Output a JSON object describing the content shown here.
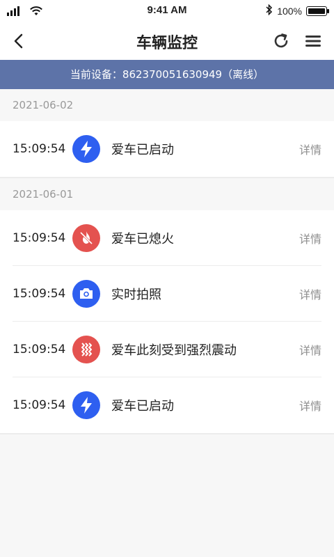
{
  "status": {
    "time": "9:41 AM",
    "battery": "100%"
  },
  "nav": {
    "title": "车辆监控"
  },
  "device": {
    "label": "当前设备：862370051630949（离线）"
  },
  "groups": [
    {
      "date": "2021-06-02",
      "items": [
        {
          "time": "15:09:54",
          "icon": "lightning-icon",
          "color": "#2e5ff0",
          "text": "爱车已启动",
          "detail": "详情"
        }
      ]
    },
    {
      "date": "2021-06-01",
      "items": [
        {
          "time": "15:09:54",
          "icon": "flame-off-icon",
          "color": "#e4524f",
          "text": "爱车已熄火",
          "detail": "详情"
        },
        {
          "time": "15:09:54",
          "icon": "camera-icon",
          "color": "#2e5ff0",
          "text": "实时拍照",
          "detail": "详情"
        },
        {
          "time": "15:09:54",
          "icon": "vibration-icon",
          "color": "#e4524f",
          "text": "爱车此刻受到强烈震动",
          "detail": "详情"
        },
        {
          "time": "15:09:54",
          "icon": "lightning-icon",
          "color": "#2e5ff0",
          "text": "爱车已启动",
          "detail": "详情"
        }
      ]
    }
  ]
}
